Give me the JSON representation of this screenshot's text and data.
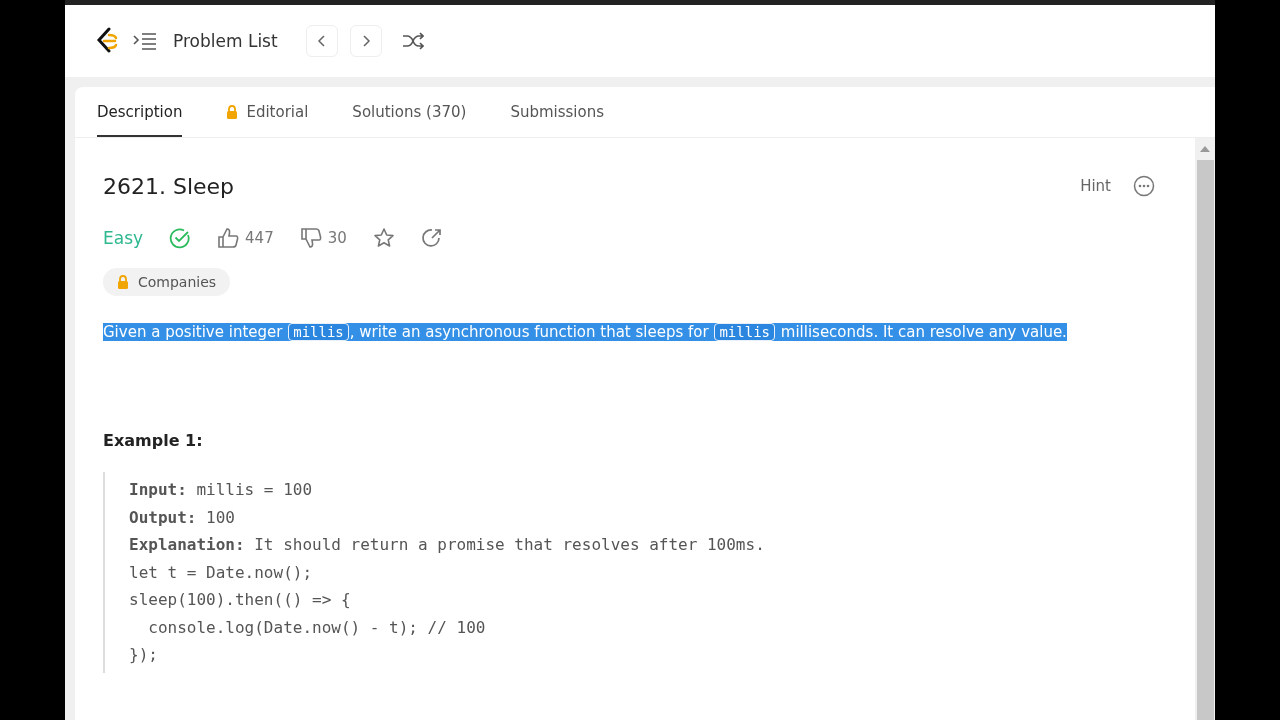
{
  "nav": {
    "title": "Problem List"
  },
  "tabs": [
    {
      "label": "Description",
      "selected": true,
      "locked": false
    },
    {
      "label": "Editorial",
      "selected": false,
      "locked": true
    },
    {
      "label": "Solutions (370)",
      "selected": false,
      "locked": false
    },
    {
      "label": "Submissions",
      "selected": false,
      "locked": false
    }
  ],
  "problem": {
    "title": "2621. Sleep",
    "hint": "Hint",
    "difficulty": "Easy",
    "solved": true,
    "likes": "447",
    "dislikes": "30",
    "companies": "Companies"
  },
  "description": {
    "highlighted": true,
    "parts": [
      {
        "kind": "text",
        "text": "Given a positive integer "
      },
      {
        "kind": "code",
        "text": "millis"
      },
      {
        "kind": "text",
        "text": ", write an asynchronous function that sleeps for "
      },
      {
        "kind": "code",
        "text": "millis"
      },
      {
        "kind": "text",
        "text": " milliseconds. It can resolve any value."
      }
    ]
  },
  "example": {
    "title": "Example 1:",
    "lines": [
      "**Input:** millis = 100",
      "**Output:** 100",
      "**Explanation:** It should return a promise that resolves after 100ms.",
      "let t = Date.now();",
      "sleep(100).then(() => {",
      "  console.log(Date.now() - t); // 100",
      "});"
    ]
  }
}
